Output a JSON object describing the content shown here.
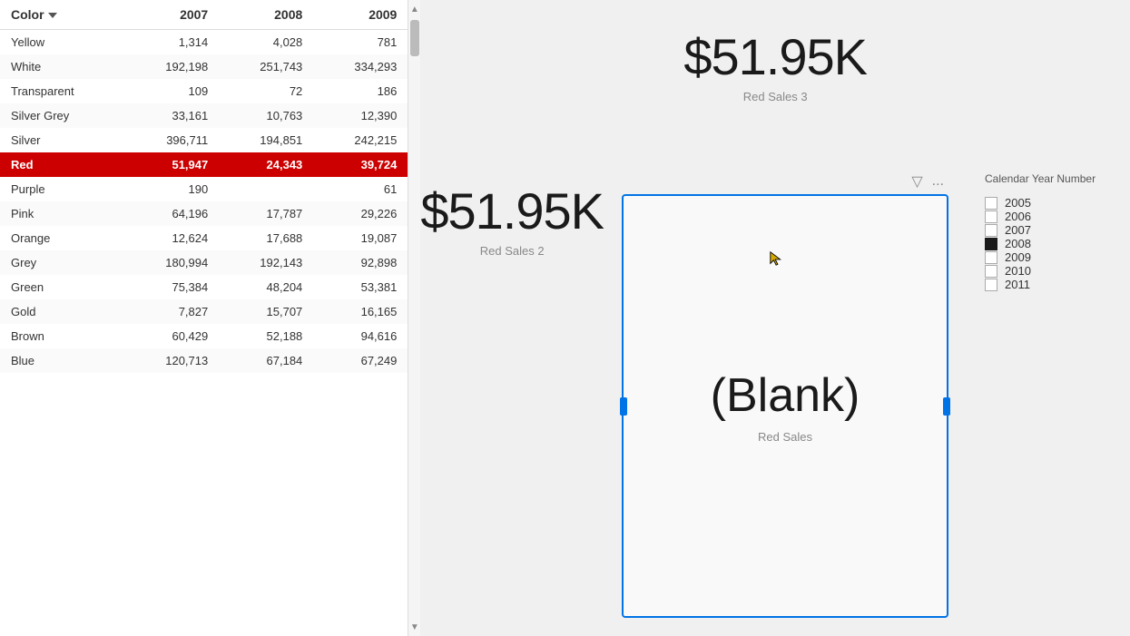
{
  "kpi_top": {
    "value": "$51.95K",
    "label": "Red Sales 3"
  },
  "kpi_middle": {
    "value": "$51.95K",
    "label": "Red Sales 2"
  },
  "kpi_blank": {
    "value": "(Blank)",
    "label": "Red Sales"
  },
  "table": {
    "headers": {
      "color": "Color",
      "y2007": "2007",
      "y2008": "2008",
      "y2009": "2009"
    },
    "rows": [
      {
        "color": "Yellow",
        "y2007": "1,314",
        "y2008": "4,028",
        "y2009": "781",
        "highlight": false
      },
      {
        "color": "White",
        "y2007": "192,198",
        "y2008": "251,743",
        "y2009": "334,293",
        "highlight": false
      },
      {
        "color": "Transparent",
        "y2007": "109",
        "y2008": "72",
        "y2009": "186",
        "highlight": false
      },
      {
        "color": "Silver Grey",
        "y2007": "33,161",
        "y2008": "10,763",
        "y2009": "12,390",
        "highlight": false
      },
      {
        "color": "Silver",
        "y2007": "396,711",
        "y2008": "194,851",
        "y2009": "242,215",
        "highlight": false
      },
      {
        "color": "Red",
        "y2007": "51,947",
        "y2008": "24,343",
        "y2009": "39,724",
        "highlight": true
      },
      {
        "color": "Purple",
        "y2007": "190",
        "y2008": "",
        "y2009": "61",
        "highlight": false
      },
      {
        "color": "Pink",
        "y2007": "64,196",
        "y2008": "17,787",
        "y2009": "29,226",
        "highlight": false
      },
      {
        "color": "Orange",
        "y2007": "12,624",
        "y2008": "17,688",
        "y2009": "19,087",
        "highlight": false
      },
      {
        "color": "Grey",
        "y2007": "180,994",
        "y2008": "192,143",
        "y2009": "92,898",
        "highlight": false
      },
      {
        "color": "Green",
        "y2007": "75,384",
        "y2008": "48,204",
        "y2009": "53,381",
        "highlight": false
      },
      {
        "color": "Gold",
        "y2007": "7,827",
        "y2008": "15,707",
        "y2009": "16,165",
        "highlight": false
      },
      {
        "color": "Brown",
        "y2007": "60,429",
        "y2008": "52,188",
        "y2009": "94,616",
        "highlight": false
      },
      {
        "color": "Blue",
        "y2007": "120,713",
        "y2008": "67,184",
        "y2009": "67,249",
        "highlight": false
      }
    ]
  },
  "legend": {
    "title": "Calendar Year Number",
    "items": [
      {
        "year": "2005",
        "checked": false
      },
      {
        "year": "2006",
        "checked": false
      },
      {
        "year": "2007",
        "checked": false
      },
      {
        "year": "2008",
        "checked": true
      },
      {
        "year": "2009",
        "checked": false
      },
      {
        "year": "2010",
        "checked": false
      },
      {
        "year": "2011",
        "checked": false
      }
    ]
  },
  "card_controls": {
    "filter_icon": "▽",
    "dots_icon": "..."
  }
}
